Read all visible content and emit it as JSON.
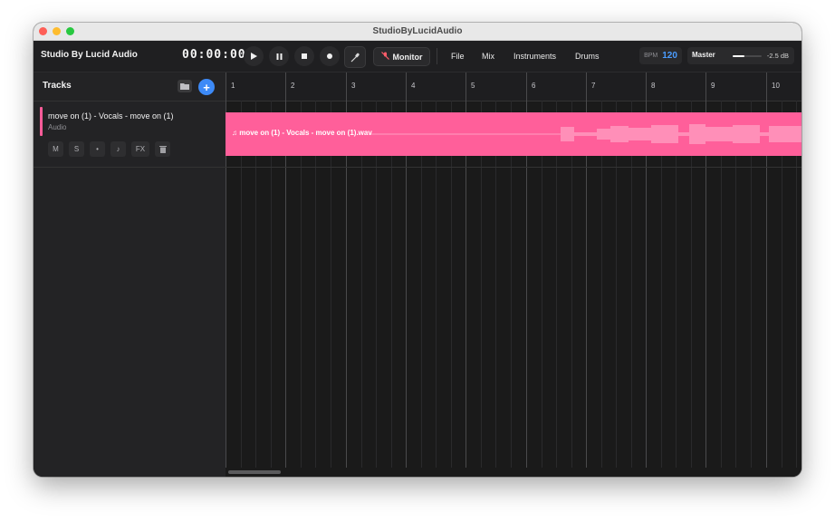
{
  "window": {
    "title": "StudioByLucidAudio"
  },
  "toolbar": {
    "app_name": "Studio By Lucid Audio",
    "timecode": "00:00:00",
    "monitor_label": "Monitor",
    "menus": [
      "File",
      "Mix",
      "Instruments",
      "Drums"
    ],
    "bpm_label": "BPM",
    "bpm_value": "120",
    "master_label": "Master",
    "master_db": "-2.5 dB",
    "master_level": 0.4
  },
  "sidebar": {
    "title": "Tracks",
    "tracks": [
      {
        "name": "move on (1) - Vocals - move on (1)",
        "type": "Audio",
        "color": "#ff5c99",
        "controls": [
          "M",
          "S",
          "•",
          "♪",
          "FX"
        ]
      }
    ]
  },
  "timeline": {
    "bars": [
      "1",
      "2",
      "3",
      "4",
      "5",
      "6",
      "7",
      "8",
      "9",
      "10"
    ],
    "clip": {
      "icon": "♫",
      "name": "move on (1) - Vocals - move on (1).wav",
      "color": "#ff5f9a"
    }
  },
  "icons": {
    "play": "play-icon",
    "pause": "pause-icon",
    "stop": "stop-icon",
    "record": "record-icon",
    "mic": "microphone-icon",
    "mic_off": "microphone-off-icon",
    "folder": "folder-icon",
    "add": "plus-icon",
    "trash": "trash-icon",
    "music": "music-note-icon"
  },
  "colors": {
    "accent": "#3d8af7",
    "bpm": "#4a9cff",
    "clip": "#ff5f9a"
  }
}
